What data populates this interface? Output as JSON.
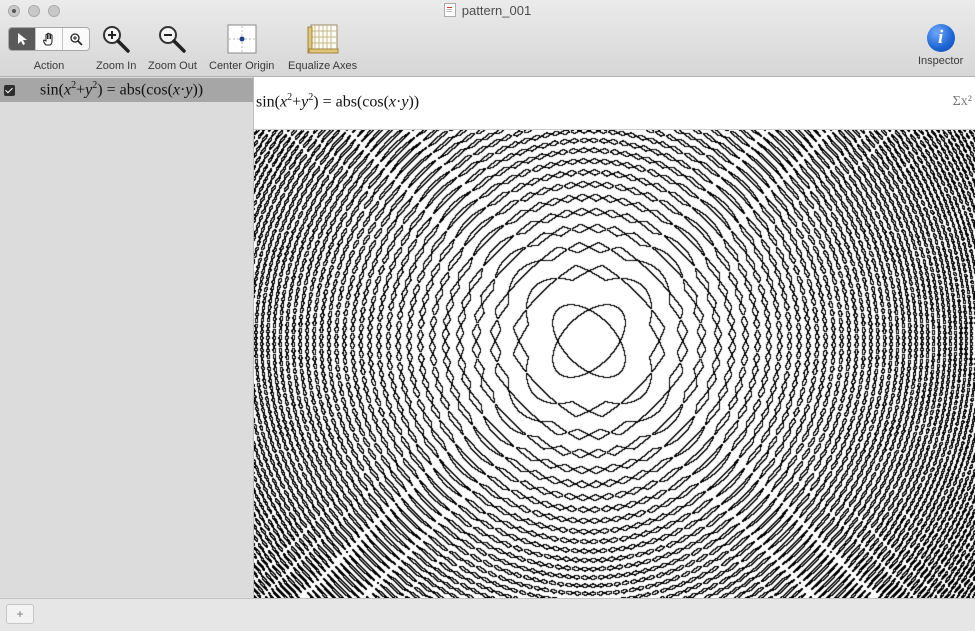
{
  "window": {
    "title": "pattern_001"
  },
  "toolbar": {
    "action_label": "Action",
    "zoom_in_label": "Zoom In",
    "zoom_out_label": "Zoom Out",
    "center_origin_label": "Center Origin",
    "equalize_axes_label": "Equalize Axes",
    "inspector_label": "Inspector",
    "inspector_glyph": "i",
    "active_tool": "pointer"
  },
  "equation": {
    "lhs_fn": "sin",
    "x": "x",
    "y": "y",
    "exp": "2",
    "plus": "+",
    "eq": "=",
    "rhs_fn": "abs",
    "cos_fn": "cos",
    "dot": "·",
    "enabled": true
  },
  "editor": {
    "sigma_label": "Σx²"
  },
  "bottom": {
    "add_label": "+"
  },
  "colors": {
    "accent": "#1d64d3",
    "plot": "#000000"
  }
}
